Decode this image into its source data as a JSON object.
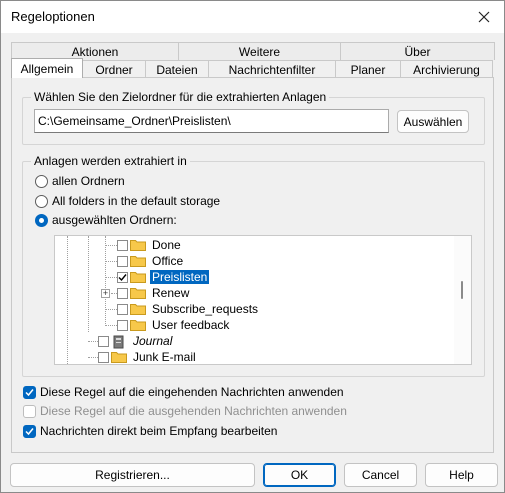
{
  "window": {
    "title": "Regeloptionen"
  },
  "tabs": {
    "back": [
      "Aktionen",
      "Weitere",
      "Über"
    ],
    "front": [
      "Allgemein",
      "Ordner",
      "Dateien",
      "Nachrichtenfilter",
      "Planer",
      "Archivierung"
    ],
    "active": "Allgemein"
  },
  "target_group": {
    "legend": "Wählen Sie den Zielordner für die extrahierten Anlagen",
    "path_value": "C:\\Gemeinsame_Ordner\\Preislisten\\",
    "select_button": "Auswählen"
  },
  "extract_group": {
    "legend": "Anlagen werden extrahiert in",
    "options": [
      "allen Ordnern",
      "All folders in the default storage",
      "ausgewählten Ordnern:"
    ],
    "selected_option": "ausgewählten Ordnern:"
  },
  "tree": {
    "items": [
      {
        "label": "Done",
        "checked": false
      },
      {
        "label": "Office",
        "checked": false
      },
      {
        "label": "Preislisten",
        "checked": true,
        "selected": true
      },
      {
        "label": "Renew",
        "checked": false,
        "expandable": true
      },
      {
        "label": "Subscribe_requests",
        "checked": false
      },
      {
        "label": "User feedback",
        "checked": false
      },
      {
        "label": "Journal",
        "checked": false,
        "italic": true,
        "icon": "journal-icon"
      },
      {
        "label": "Junk E-mail",
        "checked": false
      }
    ]
  },
  "options": {
    "incoming": {
      "label": "Diese Regel auf die eingehenden Nachrichten anwenden",
      "checked": true,
      "enabled": true
    },
    "outgoing": {
      "label": "Diese Regel auf die ausgehenden Nachrichten anwenden",
      "checked": false,
      "enabled": false
    },
    "on_receive": {
      "label": "Nachrichten direkt beim Empfang bearbeiten",
      "checked": true,
      "enabled": true
    }
  },
  "footer": {
    "register": "Registrieren...",
    "ok": "OK",
    "cancel": "Cancel",
    "help": "Help"
  },
  "colors": {
    "accent": "#0067c0",
    "folder": "#f7c84a"
  }
}
